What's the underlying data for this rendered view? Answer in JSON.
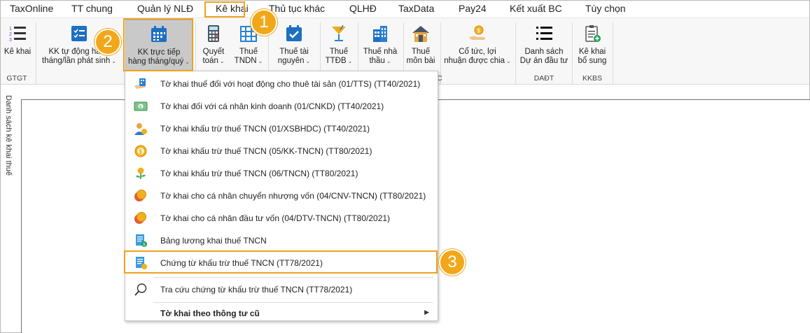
{
  "menu": [
    "TaxOnline",
    "TT chung",
    "Quản lý NLĐ",
    "Kê khai",
    "Thủ tục khác",
    "QLHĐ",
    "TaxData",
    "Pay24",
    "Kết xuất BC",
    "Tùy chọn"
  ],
  "ribbon": {
    "ke_khai": "Kê khai",
    "kk_tu_dong_1": "KK tự động hàng",
    "kk_tu_dong_2": "tháng/lần phát sinh",
    "kk_truc_tiep_1": "KK trực tiếp",
    "kk_truc_tiep_2": "hàng tháng/quý",
    "quyet_toan_1": "Quyết",
    "quyet_toan_2": "toán",
    "thue_tndn_1": "Thuế",
    "thue_tndn_2": "TNDN",
    "thue_tai_nguyen_1": "Thuế tài",
    "thue_tai_nguyen_2": "nguyên",
    "thue_ttdb_1": "Thuế",
    "thue_ttdb_2": "TTĐB",
    "thue_nha_thau_1": "Thuế nhà",
    "thue_nha_thau_2": "thầu",
    "thue_mon_bai_1": "Thuế",
    "thue_mon_bai_2": "môn bài",
    "co_tuc_1": "Cổ tức, lợi",
    "co_tuc_2": "nhuận được chia",
    "danh_sach_1": "Danh sách",
    "danh_sach_2": "Dự án đầu tư",
    "ke_khai_bs_1": "Kê khai",
    "ke_khai_bs_2": "bổ sung",
    "group_gtgt": "GTGT",
    "group_daudt": "DAĐT",
    "group_kkbs": "KKBS",
    "group_partial": "C"
  },
  "side_label": "Danh sách kê khai thuế",
  "dropdown": [
    "Tờ khai thuế đối với hoạt động cho thuê tài sản (01/TTS) (TT40/2021)",
    "Tờ khai đối với cá nhân kinh doanh (01/CNKD) (TT40/2021)",
    "Tờ khai khấu trừ thuế TNCN (01/XSBHDC) (TT40/2021)",
    "Tờ khai khấu trừ thuế TNCN (05/KK-TNCN) (TT80/2021)",
    "Tờ khai khấu trừ thuế TNCN (06/TNCN) (TT80/2021)",
    "Tờ khai cho cá nhân chuyển nhượng vốn (04/CNV-TNCN) (TT80/2021)",
    "Tờ khai cho cá nhân đầu tư vốn (04/DTV-TNCN) (TT80/2021)",
    "Bảng lương khai thuế TNCN",
    "Chứng từ khấu trừ thuế TNCN (TT78/2021)",
    "Tra cứu chứng từ khấu trừ thuế TNCN (TT78/2021)"
  ],
  "dropdown_submenu": "Tờ khai theo thông tư cũ",
  "badges": [
    "1",
    "2",
    "3"
  ],
  "colors": {
    "accent": "#f2a71b",
    "ribbon_active": "#c9c9c9"
  }
}
